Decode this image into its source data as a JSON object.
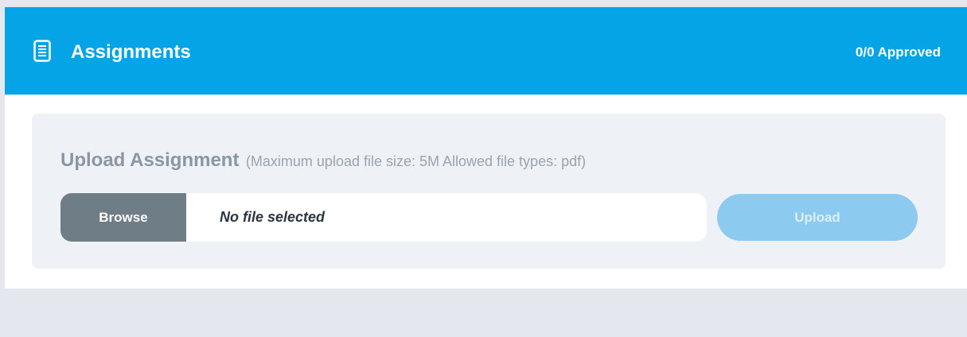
{
  "header": {
    "icon": "document-icon",
    "title": "Assignments",
    "status": "0/0 Approved"
  },
  "upload": {
    "title": "Upload Assignment",
    "limits": "(Maximum upload file size: 5M Allowed file types: pdf)",
    "browse_label": "Browse",
    "file_status": "No file selected",
    "upload_label": "Upload"
  },
  "colors": {
    "header_bg": "#05a4e6",
    "panel_bg": "#eef1f6",
    "browse_bg": "#6f7d87",
    "upload_bg": "#8ccbef",
    "page_bg": "#e4e8ee"
  }
}
